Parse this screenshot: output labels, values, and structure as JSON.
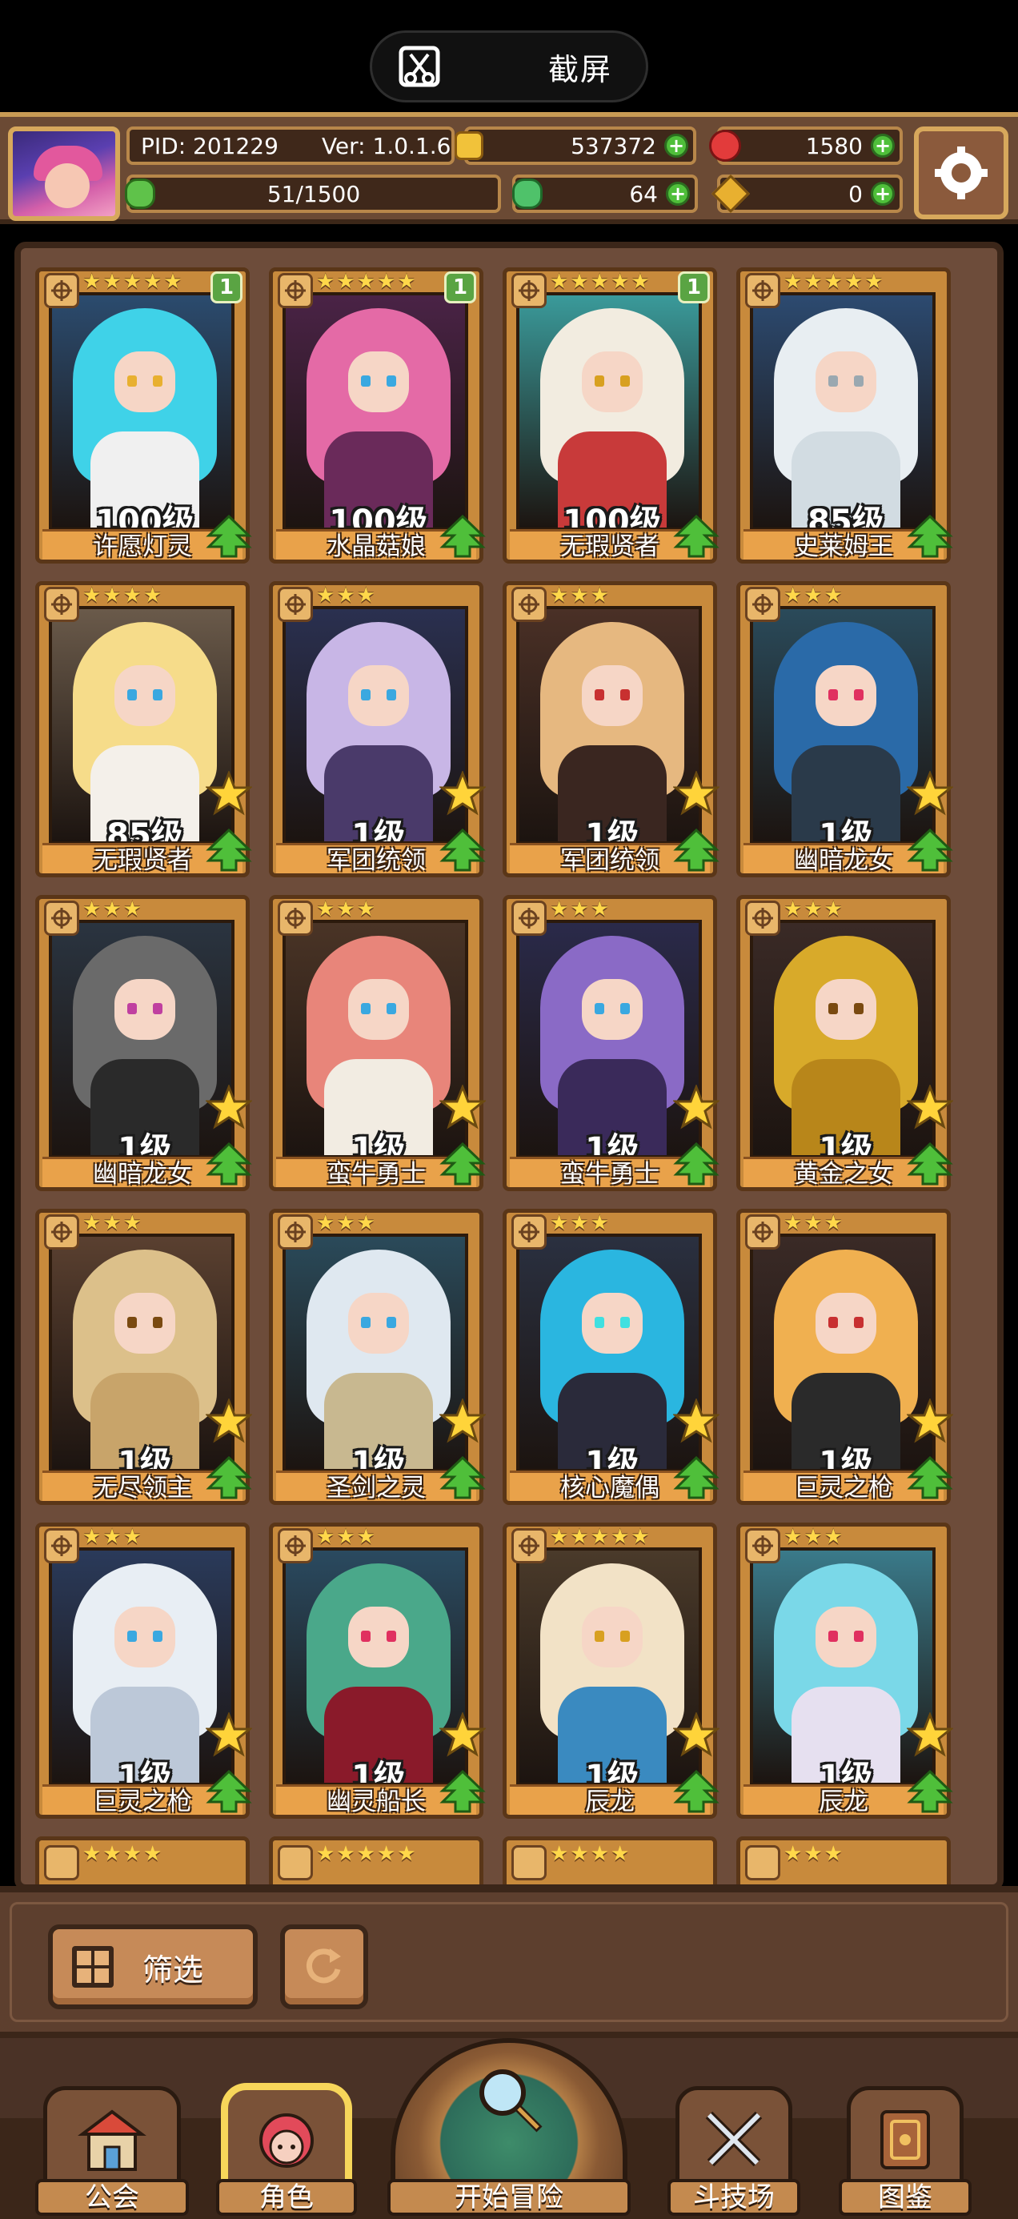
{
  "system": {
    "screenshot_label": "截屏"
  },
  "header": {
    "pid": "PID: 201229",
    "version": "Ver: 1.0.1.6",
    "gold": "537372",
    "gems": "1580",
    "stamina": "51/1500",
    "clover": "64",
    "key": "0"
  },
  "heroes": [
    {
      "name": "许愿灯灵",
      "level": "100级",
      "stars": 5,
      "badge": "1",
      "palette": "cyan"
    },
    {
      "name": "水晶菇娘",
      "level": "100级",
      "stars": 5,
      "badge": "1",
      "palette": "pink"
    },
    {
      "name": "无瑕贤者",
      "level": "100级",
      "stars": 5,
      "badge": "1",
      "palette": "white"
    },
    {
      "name": "史莱姆王",
      "level": "85级",
      "stars": 5,
      "badge": "",
      "palette": "slime"
    },
    {
      "name": "无瑕贤者",
      "level": "85级",
      "stars": 4,
      "badge": "",
      "palette": "blonde"
    },
    {
      "name": "军团统领",
      "level": "1级",
      "stars": 3,
      "badge": "",
      "palette": "purple"
    },
    {
      "name": "军团统领",
      "level": "1级",
      "stars": 3,
      "badge": "",
      "palette": "bronze"
    },
    {
      "name": "幽暗龙女",
      "level": "1级",
      "stars": 3,
      "badge": "",
      "palette": "blue"
    },
    {
      "name": "幽暗龙女",
      "level": "1级",
      "stars": 3,
      "badge": "",
      "palette": "grey"
    },
    {
      "name": "蛮牛勇士",
      "level": "1级",
      "stars": 3,
      "badge": "",
      "palette": "salmon"
    },
    {
      "name": "蛮牛勇士",
      "level": "1级",
      "stars": 3,
      "badge": "",
      "palette": "violet"
    },
    {
      "name": "黄金之女",
      "level": "1级",
      "stars": 3,
      "badge": "",
      "palette": "gold"
    },
    {
      "name": "无尽领主",
      "level": "1级",
      "stars": 3,
      "badge": "",
      "palette": "sand"
    },
    {
      "name": "圣剑之灵",
      "level": "1级",
      "stars": 3,
      "badge": "",
      "palette": "silver"
    },
    {
      "name": "核心魔偶",
      "level": "1级",
      "stars": 3,
      "badge": "",
      "palette": "teal"
    },
    {
      "name": "巨灵之枪",
      "level": "1级",
      "stars": 3,
      "badge": "",
      "palette": "orange"
    },
    {
      "name": "巨灵之枪",
      "level": "1级",
      "stars": 3,
      "badge": "",
      "palette": "ice"
    },
    {
      "name": "幽灵船长",
      "level": "1级",
      "stars": 3,
      "badge": "",
      "palette": "green"
    },
    {
      "name": "辰龙",
      "level": "1级",
      "stars": 5,
      "badge": "",
      "palette": "cream"
    },
    {
      "name": "辰龙",
      "level": "1级",
      "stars": 3,
      "badge": "",
      "palette": "aqua"
    }
  ],
  "partial_stars": [
    4,
    5,
    4,
    3
  ],
  "filter": {
    "label": "筛选"
  },
  "nav": {
    "guild": "公会",
    "character": "角色",
    "adventure": "开始冒险",
    "arena": "斗技场",
    "codex": "图鉴"
  },
  "colors": {
    "frame_brown": "#6d4c3a",
    "card_gold": "#c88a3c",
    "nameplate": "#e9a24a",
    "plus_green": "#4fbf3a",
    "active_highlight": "#f7d65a"
  }
}
